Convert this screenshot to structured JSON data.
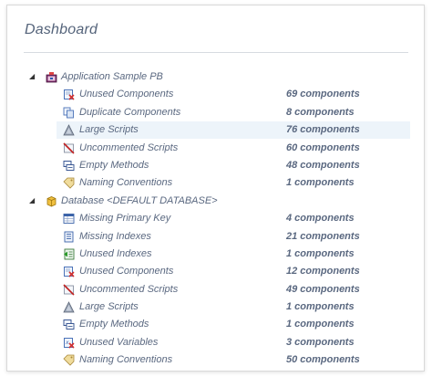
{
  "dashboard": {
    "title": "Dashboard"
  },
  "groups": [
    {
      "label": "Application Sample PB",
      "icon": "application-icon",
      "items": [
        {
          "label": "Unused Components",
          "count": "69 components",
          "icon": "unused-components-icon"
        },
        {
          "label": "Duplicate Components",
          "count": "8 components",
          "icon": "duplicate-components-icon"
        },
        {
          "label": "Large Scripts",
          "count": "76 components",
          "icon": "large-scripts-icon"
        },
        {
          "label": "Uncommented Scripts",
          "count": "60 components",
          "icon": "uncommented-scripts-icon"
        },
        {
          "label": "Empty Methods",
          "count": "48 components",
          "icon": "empty-methods-icon"
        },
        {
          "label": "Naming Conventions",
          "count": "1 components",
          "icon": "naming-conventions-icon"
        }
      ]
    },
    {
      "label": "Database <DEFAULT DATABASE>",
      "icon": "database-icon",
      "items": [
        {
          "label": "Missing Primary Key",
          "count": "4 components",
          "icon": "missing-primary-key-icon"
        },
        {
          "label": "Missing Indexes",
          "count": "21 components",
          "icon": "missing-indexes-icon"
        },
        {
          "label": "Unused Indexes",
          "count": "1 components",
          "icon": "unused-indexes-icon"
        },
        {
          "label": "Unused Components",
          "count": "12 components",
          "icon": "unused-components-icon"
        },
        {
          "label": "Uncommented Scripts",
          "count": "49 components",
          "icon": "uncommented-scripts-icon"
        },
        {
          "label": "Large Scripts",
          "count": "1 components",
          "icon": "large-scripts-icon"
        },
        {
          "label": "Empty Methods",
          "count": "1 components",
          "icon": "empty-methods-icon"
        },
        {
          "label": "Unused Variables",
          "count": "3 components",
          "icon": "unused-variables-icon"
        },
        {
          "label": "Naming Conventions",
          "count": "50 components",
          "icon": "naming-conventions-icon"
        }
      ]
    }
  ],
  "colors": {
    "title": "#54637a",
    "text": "#5a6880",
    "highlight": "#edf4fa",
    "rule": "#d7dbe0"
  }
}
